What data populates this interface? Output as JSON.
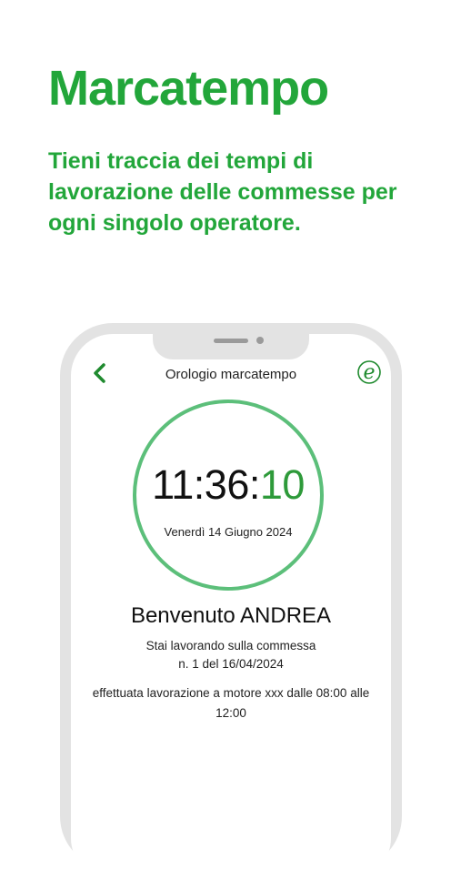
{
  "promo": {
    "headline": "Marcatempo",
    "subtitle": "Tieni traccia dei tempi di lavorazione delle commesse per ogni singolo operatore."
  },
  "colors": {
    "brand_green": "#22a63a",
    "ring_green": "#5cbf7a",
    "seconds_green": "#2e9a3a",
    "phone_frame": "#e3e3e3"
  },
  "screen": {
    "title": "Orologio marcatempo",
    "back_icon": "chevron-left-icon",
    "logo_icon": "e-logo-icon",
    "clock": {
      "hours_minutes": "11:36:",
      "seconds": "10",
      "date": "Venerdì 14 Giugno 2024"
    },
    "welcome": "Benvenuto ANDREA",
    "working_line1": "Stai lavorando sulla commessa",
    "working_line2": "n. 1 del 16/04/2024",
    "note": "effettuata lavorazione a motore xxx dalle 08:00 alle 12:00"
  }
}
